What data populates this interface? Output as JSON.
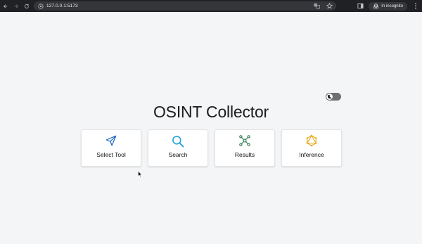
{
  "browser": {
    "url": "127.0.0.1:5173",
    "incognito_label": "In incognito"
  },
  "page": {
    "title": "OSINT Collector",
    "theme_toggle": {
      "state": "off"
    },
    "cards": [
      {
        "label": "Select Tool",
        "icon": "send-icon",
        "color": "#1565c0"
      },
      {
        "label": "Search",
        "icon": "search-icon",
        "color": "#2aa6d9"
      },
      {
        "label": "Results",
        "icon": "graph-icon",
        "color": "#2e7d4f"
      },
      {
        "label": "Inference",
        "icon": "graphql-icon",
        "color": "#e6a817"
      }
    ]
  }
}
